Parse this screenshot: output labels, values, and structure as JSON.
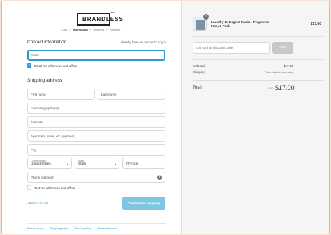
{
  "brand": {
    "logo_text": "BRANDLESS",
    "trademark": "TM"
  },
  "breadcrumb": {
    "items": [
      {
        "label": "Cart",
        "state": "link"
      },
      {
        "label": "Information",
        "state": "active"
      },
      {
        "label": "Shipping",
        "state": "plain"
      },
      {
        "label": "Payment",
        "state": "plain"
      }
    ],
    "separator": "›"
  },
  "contact": {
    "title": "Contact information",
    "account_prompt": "Already have an account?",
    "login_label": "Log in",
    "email_placeholder": "Email",
    "newsletter_label": "Email me with news and offers",
    "newsletter_checked": true
  },
  "shipping": {
    "title": "Shipping address",
    "first_name_placeholder": "First name",
    "last_name_placeholder": "Last name",
    "company_placeholder": "Company (optional)",
    "address_placeholder": "Address",
    "apartment_placeholder": "Apartment, suite, etc. (optional)",
    "city_placeholder": "City",
    "country_label": "Country/region",
    "country_value": "United States",
    "state_label": "State",
    "state_value": "State",
    "zip_placeholder": "ZIP code",
    "phone_placeholder": "Phone (optional)",
    "sms_label": "Text me with news and offers",
    "sms_checked": false
  },
  "actions": {
    "return_label": "‹ Return to cart",
    "continue_label": "Continue to shipping"
  },
  "footer": {
    "links": [
      "Refund policy",
      "Shipping policy",
      "Privacy policy",
      "Terms of service"
    ]
  },
  "summary": {
    "product": {
      "name": "Laundry Detergent Packs - Fragrance Free, 2-Pack",
      "price": "$17.00",
      "quantity": "1"
    },
    "discount_placeholder": "Gift card or discount code",
    "apply_label": "Apply",
    "subtotal_label": "Subtotal",
    "subtotal_value": "$17.00",
    "shipping_label": "Shipping",
    "shipping_value": "Calculated at next step",
    "total_label": "Total",
    "total_currency": "USD",
    "total_value": "$17.00"
  },
  "colors": {
    "accent": "#2a9dcc",
    "button_disabled": "#7fc6e0",
    "apply_button": "#c8c8c8",
    "page_border": "#e8b49a"
  }
}
